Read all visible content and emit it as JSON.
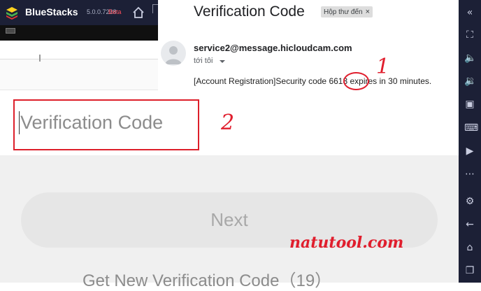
{
  "bluestacks": {
    "app_name": "BlueStacks",
    "version": "5.0.0.7228",
    "beta": "Beta"
  },
  "email": {
    "subject": "Verification Code",
    "label_chip": "Hộp thư đến",
    "label_chip_close": "×",
    "sender": "service2@message.hicloudcam.com",
    "recipient": "tới tôi",
    "body_prefix": "[Account Registration]Security code ",
    "code": "6613",
    "body_suffix": " expires in 30 minutes."
  },
  "annotations": {
    "step1": "1",
    "step2": "2",
    "watermark": "natutool.com",
    "highlight_color": "#e01e2d"
  },
  "form": {
    "code_placeholder": "Verification Code",
    "next_button": "Next",
    "resend_link": "Get New Verification Code（19）"
  },
  "sidebar": {
    "icons": [
      "collapse-icon",
      "fullscreen-icon",
      "volume-up-icon",
      "volume-down-icon",
      "screen-record-icon",
      "play-icon",
      "keyboard-icon",
      "media-icon",
      "more-icon",
      "settings-icon",
      "back-icon",
      "home-icon",
      "recent-apps-icon"
    ]
  }
}
